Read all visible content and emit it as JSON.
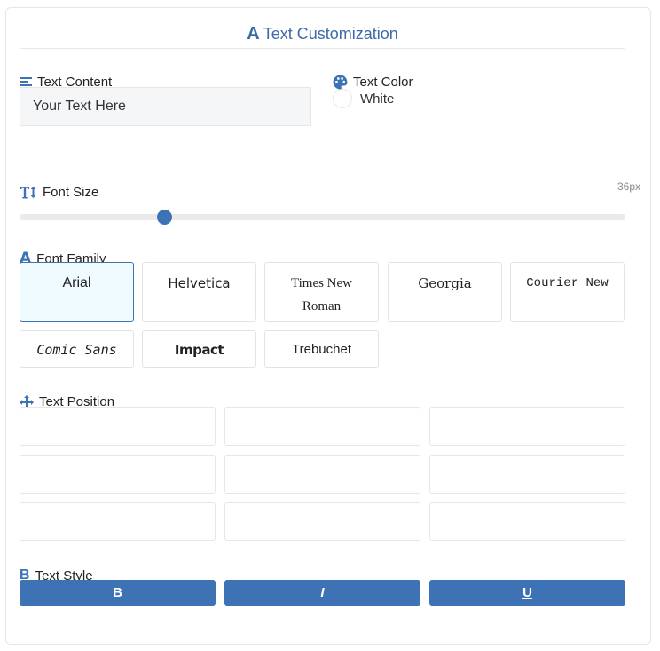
{
  "panel": {
    "title": "Text Customization"
  },
  "text_content": {
    "label": "Text Content",
    "value": "Your Text Here"
  },
  "text_color": {
    "label": "Text Color",
    "selected_name": "White",
    "selected_hex": "#ffffff"
  },
  "font_size": {
    "label": "Font Size",
    "value_text": "36px",
    "slider_fraction": 0.24
  },
  "font_family": {
    "label": "Font Family",
    "options": [
      "Arial",
      "Helvetica",
      "Times New Roman",
      "Georgia",
      "Courier New",
      "Comic Sans",
      "Impact",
      "Trebuchet"
    ],
    "selected": "Arial"
  },
  "text_position": {
    "label": "Text Position"
  },
  "text_style": {
    "label": "Text Style",
    "buttons": [
      "B",
      "I",
      "U"
    ]
  },
  "colors": {
    "accent": "#3d72b4",
    "title": "#3d6aa6",
    "active_bg": "#f0fbff"
  }
}
